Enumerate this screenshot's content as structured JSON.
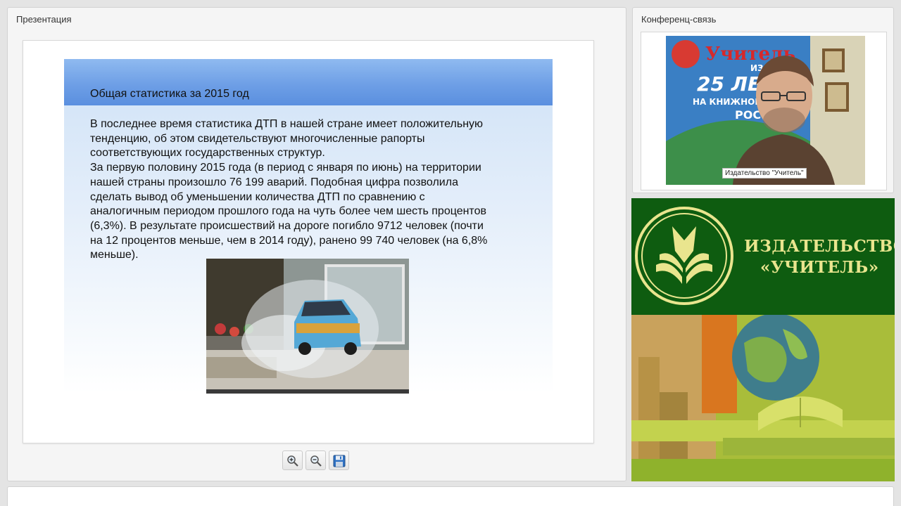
{
  "presentation": {
    "title": "Презентация",
    "slide": {
      "heading": "Общая статистика за 2015 год",
      "lines": [
        "В последнее время статистика ДТП в нашей стране имеет положительную",
        "тенденцию, об этом свидетельствуют многочисленные рапорты",
        "соответствующих государственных структур.",
        "За первую половину 2015 года (в период с января по июнь) на территории",
        "нашей страны произошло 76 199 аварий. Подобная цифра позволила",
        "сделать вывод об уменьшении количества ДТП по сравнению с",
        "аналогичным периодом прошлого года на чуть более чем шесть процентов",
        "(6,3%). В результате происшествий на дороге погибло 9712 человек (почти",
        "на 12 процентов меньше, чем в 2014 году), ранено 99 740 человек (на 6,8%",
        "меньше)."
      ]
    },
    "toolbar": {
      "zoom_in": "zoom-in-icon",
      "zoom_out": "zoom-out-icon",
      "save": "save-icon"
    }
  },
  "conference": {
    "title": "Конференц-связь",
    "participant_name": "Издательство \"Учитель\"",
    "backdrop_text": {
      "brand": "Учитель",
      "sub": "ИЗДАТ",
      "years": "25 ЛЕТ",
      "tagline": "НА КНИЖНОМ Р",
      "country": "РОСС"
    }
  },
  "banner": {
    "name_line1": "ИЗДАТЕЛЬСТВО",
    "name_line2": "«УЧИТЕЛЬ»",
    "accent_color": "#0e5c10",
    "text_color": "#e9e58e"
  }
}
